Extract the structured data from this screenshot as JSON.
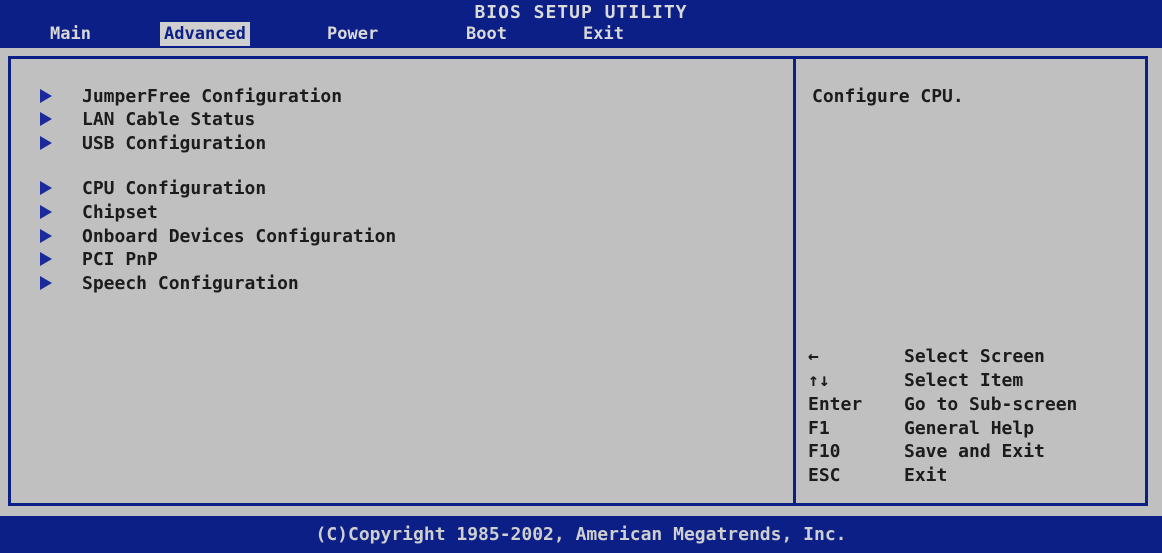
{
  "header": {
    "title": "BIOS SETUP UTILITY",
    "tabs": [
      {
        "label": "Main"
      },
      {
        "label": "Advanced"
      },
      {
        "label": "Power"
      },
      {
        "label": "Boot"
      },
      {
        "label": "Exit"
      }
    ],
    "active_tab": "Advanced"
  },
  "menu": {
    "items": [
      {
        "label": "JumperFree Configuration"
      },
      {
        "label": "LAN Cable Status"
      },
      {
        "label": "USB Configuration"
      },
      {
        "label": "CPU Configuration"
      },
      {
        "label": "Chipset"
      },
      {
        "label": "Onboard Devices Configuration"
      },
      {
        "label": "PCI PnP"
      },
      {
        "label": "Speech Configuration"
      }
    ],
    "item_icon": "right-triangle-arrow"
  },
  "help": {
    "text": "Configure CPU."
  },
  "keys": [
    {
      "key": "←",
      "action": "Select Screen"
    },
    {
      "key": "↑↓",
      "action": "Select Item"
    },
    {
      "key": "Enter",
      "action": "Go to Sub-screen"
    },
    {
      "key": "F1",
      "action": "General Help"
    },
    {
      "key": "F10",
      "action": "Save and Exit"
    },
    {
      "key": "ESC",
      "action": "Exit"
    }
  ],
  "footer": {
    "copyright": "(C)Copyright 1985-2002, American Megatrends, Inc."
  },
  "colors": {
    "bios_blue": "#0b1f86",
    "panel_gray": "#c0c0c0",
    "text_dark": "#1c1c1c",
    "header_text": "#d9d9d9"
  }
}
